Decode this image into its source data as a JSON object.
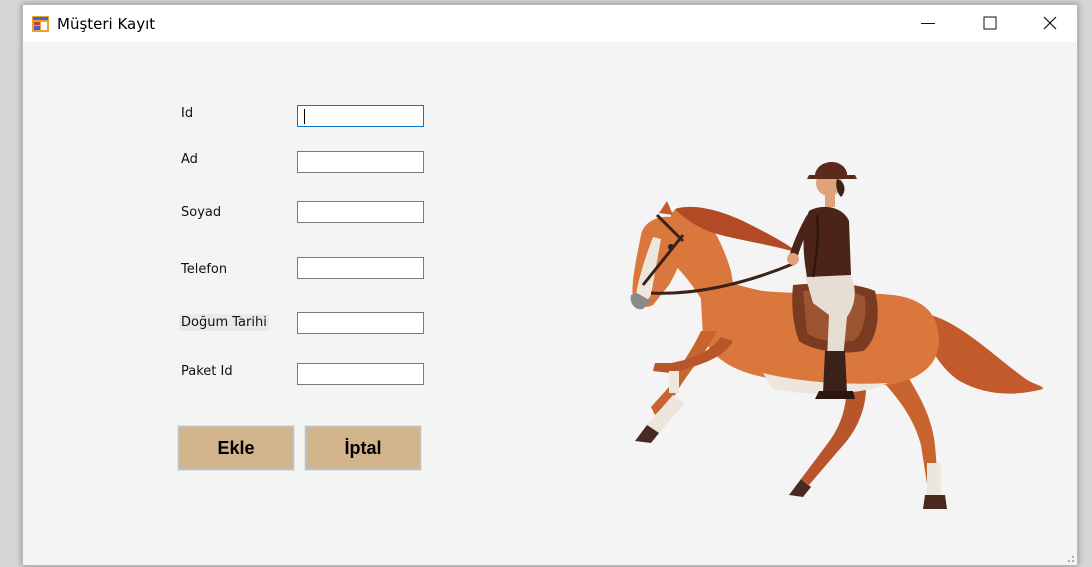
{
  "window": {
    "title": "Müşteri Kayıt"
  },
  "form": {
    "fields": [
      {
        "label": "Id",
        "value": ""
      },
      {
        "label": "Ad",
        "value": ""
      },
      {
        "label": "Soyad",
        "value": ""
      },
      {
        "label": "Telefon",
        "value": ""
      },
      {
        "label": "Doğum Tarihi",
        "value": ""
      },
      {
        "label": "Paket Id",
        "value": ""
      }
    ]
  },
  "buttons": {
    "add": "Ekle",
    "cancel": "İptal"
  },
  "colors": {
    "button_bg": "#d2b48c",
    "focus_border": "#0078d7",
    "form_bg": "#f4f4f4"
  },
  "icons": [
    "app-form-icon",
    "minimize-icon",
    "maximize-icon",
    "close-icon",
    "horse-rider-illustration",
    "resize-grip-icon"
  ]
}
